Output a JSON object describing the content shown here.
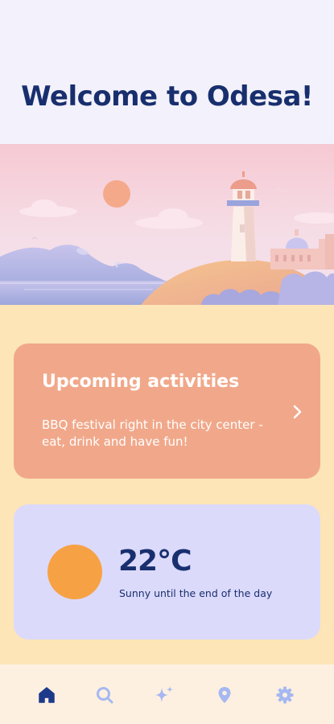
{
  "header": {
    "title": "Welcome to Odesa!"
  },
  "activities": {
    "title": "Upcoming activities",
    "description": "BBQ festival right in the city center - eat, drink and have fun!"
  },
  "weather": {
    "temperature": "22°C",
    "description": "Sunny until the end of the day"
  },
  "nav": {
    "items": [
      {
        "icon": "home-icon",
        "active": true
      },
      {
        "icon": "search-icon",
        "active": false
      },
      {
        "icon": "sparkle-icon",
        "active": false
      },
      {
        "icon": "map-pin-icon",
        "active": false
      },
      {
        "icon": "gear-icon",
        "active": false
      }
    ]
  },
  "colors": {
    "primary_text": "#182f6e",
    "page_background": "#fde5b7",
    "header_background": "#f3f1fb",
    "activities_card": "#f1a88a",
    "weather_card": "#dcdafb",
    "sun": "#f6a244",
    "nav_background": "#fdf0e1",
    "nav_active": "#1d3a8a",
    "nav_inactive": "#a6b8f1"
  }
}
